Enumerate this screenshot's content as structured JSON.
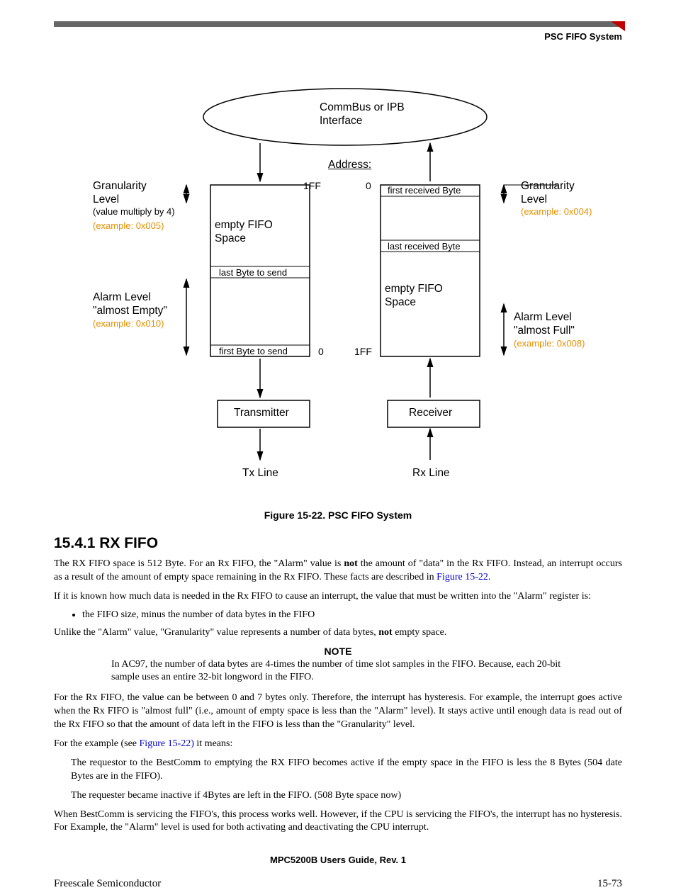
{
  "header": {
    "section_title": "PSC FIFO System"
  },
  "diagram": {
    "top_label": "CommBus or IPB\nInterface",
    "address_label": "Address:",
    "addr_1ff_top": "1FF",
    "addr_0_top": "0",
    "addr_0_bot": "0",
    "addr_1ff_bot": "1FF",
    "left_gran_title": "Granularity Level",
    "left_gran_mult": "(value multiply by 4)",
    "left_gran_ex": "(example: 0x005)",
    "right_gran_title": "Granularity Level",
    "right_gran_ex": "(example: 0x004)",
    "empty_fifo_label": "empty FIFO Space",
    "last_byte_send": "last Byte to send",
    "first_byte_send": "first Byte to send",
    "first_recv": "first received Byte",
    "last_recv": "last received Byte",
    "alarm_left_title": "Alarm Level \"almost Empty\"",
    "alarm_left_ex": "(example: 0x010)",
    "alarm_right_title": "Alarm Level \"almost Full\"",
    "alarm_right_ex": "(example: 0x008)",
    "tx_box": "Transmitter",
    "rx_box": "Receiver",
    "tx_line": "Tx Line",
    "rx_line": "Rx Line"
  },
  "caption": "Figure 15-22. PSC FIFO System",
  "section_heading": "15.4.1    RX FIFO",
  "paragraphs": {
    "p1a": "The RX FIFO space is 512 Byte. For an Rx FIFO, the \"Alarm\" value is ",
    "p1_not": "not",
    "p1b": " the amount of \"data\" in the Rx FIFO. Instead, an interrupt occurs as a result of the amount of empty space remaining in the Rx FIFO. These facts are described in ",
    "p1_link": "Figure 15-22",
    "p1c": ".",
    "p2": "If it is known how much data is needed in the Rx FIFO to cause an interrupt, the value that must be written into the \"Alarm\" register is:",
    "li1": "the FIFO size, minus the number of data bytes in the FIFO",
    "p3a": "Unlike the \"Alarm\" value, \"Granularity\" value represents a number of data bytes, ",
    "p3_not": "not",
    "p3b": " empty space.",
    "note_label": "NOTE",
    "note_body": "In AC97, the number of data bytes are 4-times the number of time slot samples in the FIFO. Because, each 20-bit sample uses an entire 32-bit longword in the FIFO.",
    "p4": "For the Rx FIFO, the value can be between 0 and 7 bytes only. Therefore, the interrupt has hysteresis. For example, the interrupt goes active when the Rx FIFO is \"almost full\" (i.e., amount of empty space is less than the \"Alarm\" level). It stays active until enough data is read out of the Rx FIFO so that the amount of data left in the FIFO is less than the \"Granularity\" level.",
    "p5a": "For the example (see ",
    "p5_link": "Figure 15-22)",
    "p5b": " it means:",
    "ind1": "The requestor to the BestComm to emptying the RX FIFO becomes active if the empty space in the FIFO is less the 8 Bytes (504 date Bytes are in the FIFO).",
    "ind2": "The requester became inactive if 4Bytes are left in the FIFO. (508 Byte space now)",
    "p6": "When BestComm is servicing the FIFO's, this process works well. However, if the CPU is servicing the FIFO's, the interrupt has no hysteresis. For Example, the \"Alarm\" level is used for both activating and deactivating the CPU interrupt."
  },
  "footer": {
    "doc_id": "MPC5200B Users Guide, Rev. 1",
    "vendor": "Freescale Semiconductor",
    "page_num": "15-73"
  }
}
